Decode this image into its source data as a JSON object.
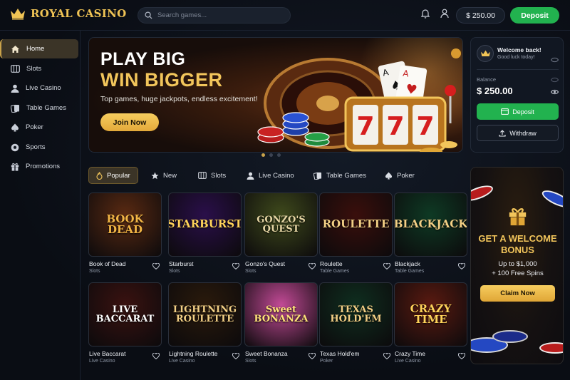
{
  "header": {
    "brand": "ROYAL CASINO",
    "search_placeholder": "Search games...",
    "balance": "$ 250.00",
    "deposit_label": "Deposit"
  },
  "sidebar": {
    "items": [
      {
        "label": "Home",
        "icon": "home-icon",
        "active": true
      },
      {
        "label": "Slots",
        "icon": "slots-icon",
        "active": false
      },
      {
        "label": "Live Casino",
        "icon": "user-icon",
        "active": false
      },
      {
        "label": "Table Games",
        "icon": "cards-icon",
        "active": false
      },
      {
        "label": "Poker",
        "icon": "spade-icon",
        "active": false
      },
      {
        "label": "Sports",
        "icon": "soccer-ball-icon",
        "active": false
      },
      {
        "label": "Promotions",
        "icon": "gift-icon",
        "active": false
      }
    ]
  },
  "hero": {
    "title_line1": "PLAY BIG",
    "title_line2": "WIN BIGGER",
    "subtitle": "Top games, huge jackpots, endless excitement!",
    "cta": "Join Now",
    "slot_digits": [
      "7",
      "7",
      "7"
    ]
  },
  "welcome": {
    "title": "Welcome back!",
    "subtitle": "Good luck today!",
    "balance_label": "Balance",
    "balance": "$ 250.00",
    "deposit_label": "Deposit",
    "withdraw_label": "Withdraw"
  },
  "tabs": [
    {
      "label": "Popular",
      "icon": "flame-icon",
      "active": true
    },
    {
      "label": "New",
      "icon": "star-icon",
      "active": false
    },
    {
      "label": "Slots",
      "icon": "slots-icon",
      "active": false
    },
    {
      "label": "Live Casino",
      "icon": "user-icon",
      "active": false
    },
    {
      "label": "Table Games",
      "icon": "cards-icon",
      "active": false
    },
    {
      "label": "Poker",
      "icon": "spade-icon",
      "active": false
    }
  ],
  "games": [
    {
      "name": "Book of Dead",
      "category": "Slots",
      "thumb_text": "BOOK DEAD",
      "bg": "#5a2a12",
      "fg": "#f2b545"
    },
    {
      "name": "Starburst",
      "category": "Slots",
      "thumb_text": "STARBURST",
      "bg": "#2a0f4a",
      "fg": "#ffd35a"
    },
    {
      "name": "Gonzo's Quest",
      "category": "Slots",
      "thumb_text": "GONZO'S QUEST",
      "bg": "#3f4a1c",
      "fg": "#e7d7a5"
    },
    {
      "name": "Roulette",
      "category": "Table Games",
      "thumb_text": "ROULETTE",
      "bg": "#3a0f0c",
      "fg": "#f2cf85"
    },
    {
      "name": "Blackjack",
      "category": "Table Games",
      "thumb_text": "BLACKJACK",
      "bg": "#0e3a24",
      "fg": "#f2cf85"
    },
    {
      "name": "Live Baccarat",
      "category": "Live Casino",
      "thumb_text": "LIVE BACCARAT",
      "bg": "#3a1210",
      "fg": "#ffffff"
    },
    {
      "name": "Lightning Roulette",
      "category": "Live Casino",
      "thumb_text": "LIGHTNING ROULETTE",
      "bg": "#2a1a0c",
      "fg": "#f2cf85"
    },
    {
      "name": "Sweet Bonanza",
      "category": "Slots",
      "thumb_text": "Sweet BONANZA",
      "bg": "#c24a96",
      "fg": "#ffe27a"
    },
    {
      "name": "Texas Hold'em",
      "category": "Poker",
      "thumb_text": "TEXAS HOLD'EM",
      "bg": "#0f2e1f",
      "fg": "#f2cf85"
    },
    {
      "name": "Crazy Time",
      "category": "Live Casino",
      "thumb_text": "CRAZY TIME",
      "bg": "#5a1a10",
      "fg": "#ffd35a"
    }
  ],
  "promo": {
    "title": "GET A WELCOME BONUS",
    "line1": "Up to $1,000",
    "line2": "+ 100 Free Spins",
    "cta": "Claim Now"
  },
  "colors": {
    "accent_gold": "#f2c55b",
    "deposit_green": "#22b24f",
    "background": "#0b0f17"
  }
}
